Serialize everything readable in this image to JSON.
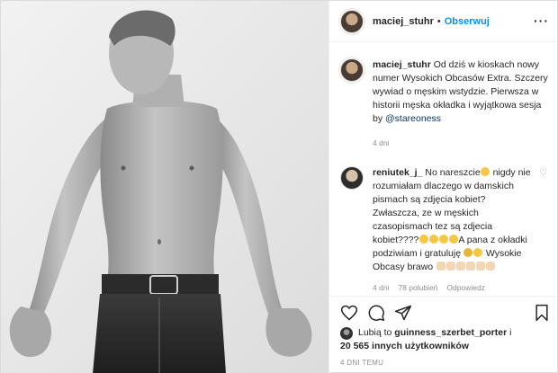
{
  "header": {
    "username": "maciej_stuhr",
    "separator": "•",
    "follow_label": "Obserwuj",
    "more_icon": "more-icon"
  },
  "caption": {
    "username": "maciej_stuhr",
    "text": "Od dziś w kioskach nowy numer Wysokich Obcasów Extra. Szczery wywiad o męskim wstydzie. Pierwsza w historii męska okładka i wyjątkowa sesja by",
    "mention": "@stareoness",
    "time": "4 dni"
  },
  "comment": {
    "username": "reniutek_j_",
    "text_1": "No nareszcie",
    "text_2": " nigdy nie rozumiałam dlaczego w damskich pismach są zdjęcia kobiet? Zwłaszcza, ze w męskich czasopismach tez są zdjecia kobiet????",
    "text_3": "A pana z okładki podziwiam i gratuluję ",
    "text_4": " Wysokie Obcasy brawo",
    "time": "4 dni",
    "likes": "78 polubień",
    "reply_label": "Odpowiedz"
  },
  "actions": {
    "like_icon": "heart-icon",
    "comment_icon": "comment-icon",
    "share_icon": "share-icon",
    "save_icon": "bookmark-icon"
  },
  "likes": {
    "prefix": "Lubią to",
    "user": "guinness_szerbet_porter",
    "conj": "i",
    "others": "20 565 innych użytkowników"
  },
  "post_date": "4 DNI TEMU",
  "colors": {
    "link": "#0095f6",
    "mention": "#00376b",
    "muted": "#8e8e8e",
    "border": "#dbdbdb"
  }
}
